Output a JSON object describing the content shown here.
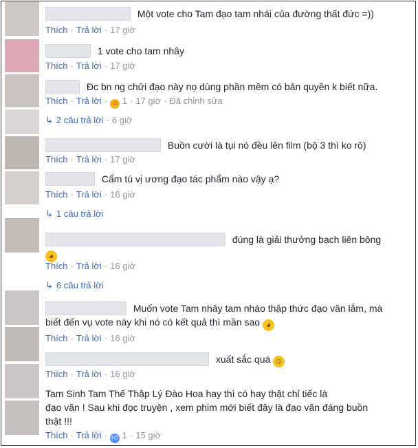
{
  "colors": {
    "link": "#4267b2",
    "meta": "#90949c",
    "text": "#1d2129",
    "avatar_palette": [
      "#c9c4c2",
      "#d9a7b2",
      "#c8c2be",
      "#d3d0cf",
      "#b9b3ae",
      "#cfcac8",
      "#c3bcb8",
      "#c6c3c3",
      "#bdb7b5",
      "#ccc8c7"
    ]
  },
  "labels": {
    "like": "Thích",
    "reply": "Trả lời",
    "edited": "Đã chỉnh sửa",
    "dot": "·"
  },
  "comments": [
    {
      "text": "Một vote cho Tam đạo tam nhái của đường thất đức =))",
      "time": "17 giờ"
    },
    {
      "text": "1 vote cho tam nhây",
      "time": "17 giờ"
    },
    {
      "text": "Đc bn ng chửi đạo này nọ dùng phần mềm có bản quyền k biết nữa.",
      "reaction_icon": "haha-icon",
      "reaction_count": "1",
      "time": "17 giờ",
      "edited": "Đã chỉnh sửa"
    },
    {
      "text": "Buồn cười là tụi nó đều lên film (bộ 3 thì ko rõ)",
      "time": "17 giờ"
    },
    {
      "text": "Cẩm tú vị ương đạo tác phẩm nào vậy ạ?",
      "time": "16 giờ"
    },
    {
      "text": "đúng là giải thưởng bạch liên bông",
      "emoji": "pacman-emoji-icon",
      "time": "16 giờ"
    },
    {
      "text_line1": "Muốn vote Tam nhây tam nháo thập thức đạo văn lắm, mà",
      "text_line2": "biết đến vụ vote này khi nó có kết quả thì mần sao",
      "emoji": "pacman-emoji-icon",
      "time": "16 giờ"
    },
    {
      "text": "xuất sắc quá",
      "emoji": "smile-emoji-icon",
      "time": "16 giờ"
    },
    {
      "text_line1": "Tam Sinh Tam Thế Thập Lý Đào Hoa hay thì có hay thật chỉ tiếc là",
      "text_line2": "đạo văn ! Sau khi đọc truyện , xem phim mới biết đây là đạo văn đáng buồn",
      "text_line3": "thật !!!",
      "reaction_icon": "like-icon",
      "reaction_count": "1",
      "time": "15 giờ"
    }
  ],
  "replies": [
    {
      "label": "2 câu trả lời",
      "time": "6 giờ"
    },
    {
      "label": "1 câu trả lời"
    },
    {
      "label": "6 câu trả lời"
    }
  ]
}
